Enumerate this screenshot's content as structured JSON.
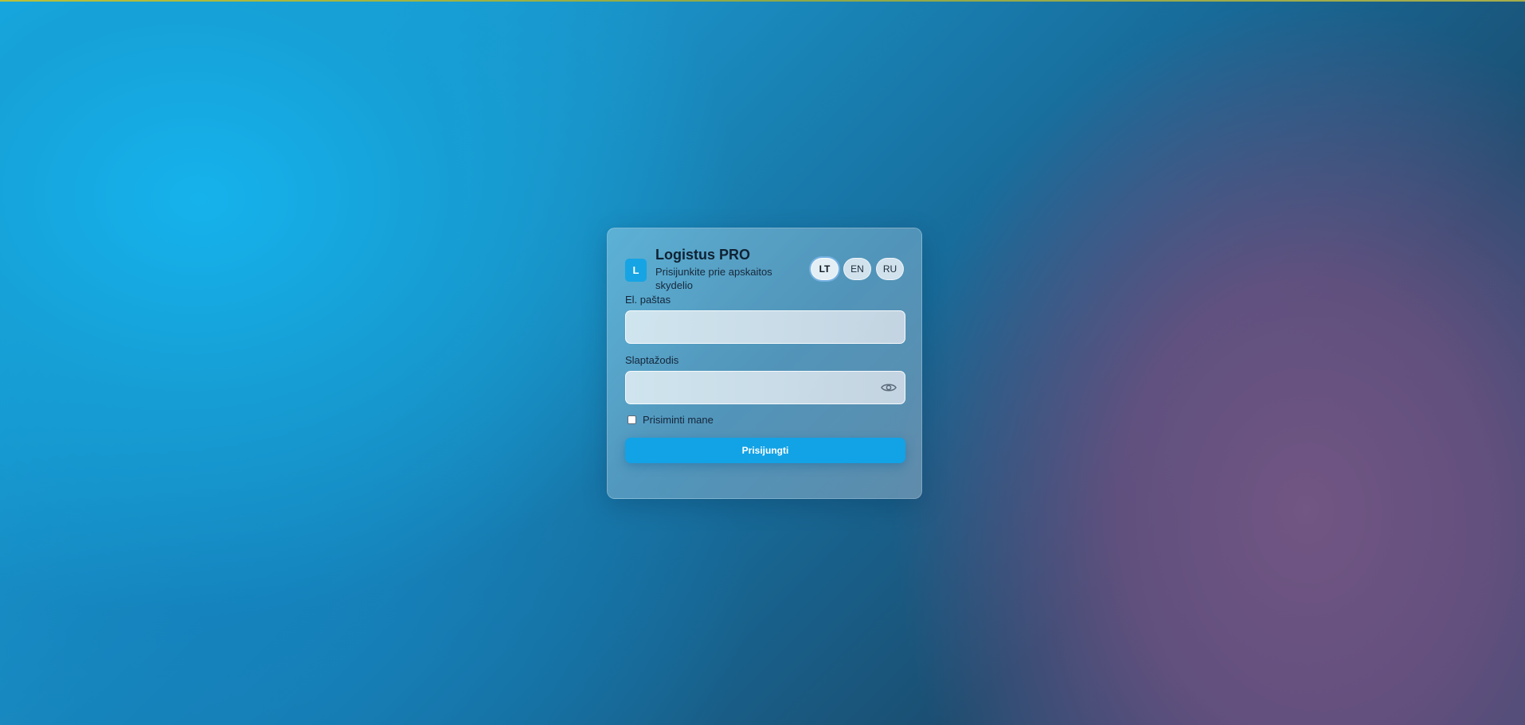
{
  "app": {
    "logo_letter": "L",
    "title": "Logistus PRO",
    "subtitle": "Prisijunkite prie apskaitos skydelio"
  },
  "languages": [
    {
      "code": "LT",
      "active": true
    },
    {
      "code": "EN",
      "active": false
    },
    {
      "code": "RU",
      "active": false
    }
  ],
  "form": {
    "email_label": "El. paštas",
    "email_value": "",
    "password_label": "Slaptažodis",
    "password_value": "",
    "remember_label": "Prisiminti mane",
    "remember_checked": false,
    "submit_label": "Prisijungti"
  },
  "colors": {
    "accent": "#12a2e6",
    "logo_bg": "#16a4e4"
  },
  "icons": {
    "password_toggle": "eye-icon"
  }
}
